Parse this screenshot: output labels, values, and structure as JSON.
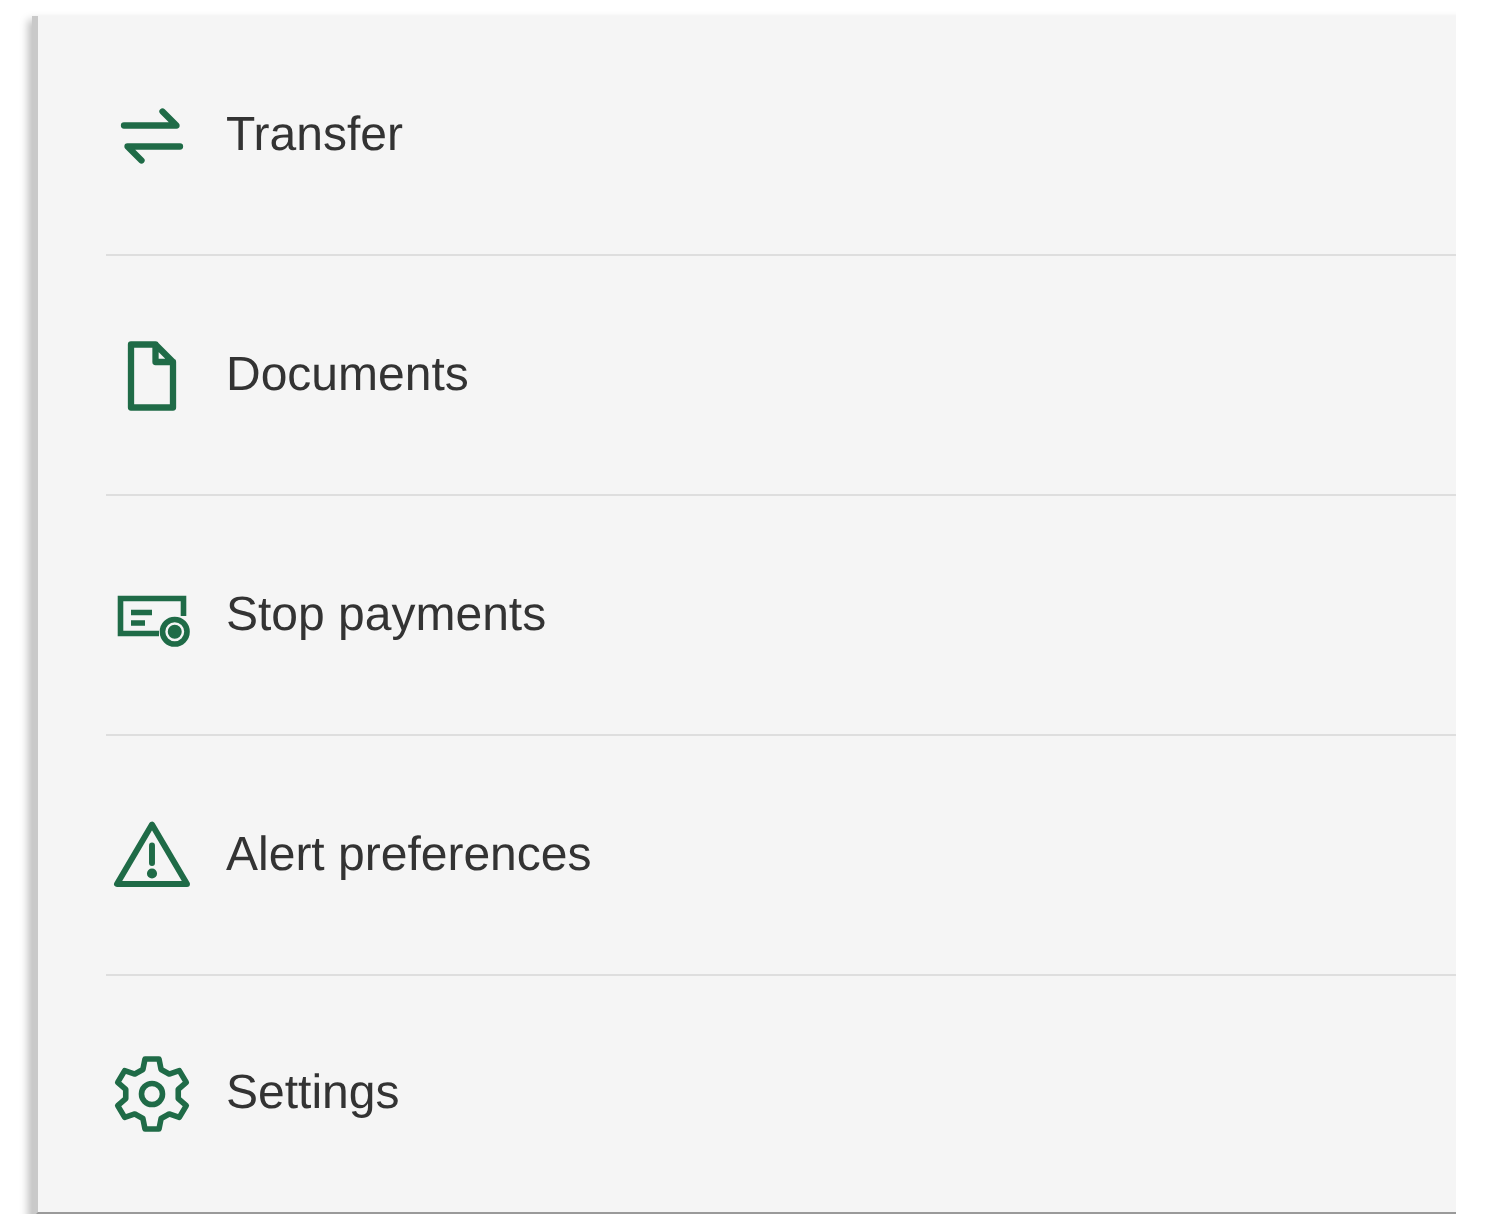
{
  "menu": {
    "items": [
      {
        "kind": "transfer",
        "label": "Transfer"
      },
      {
        "kind": "document",
        "label": "Documents"
      },
      {
        "kind": "stop-payment",
        "label": "Stop payments"
      },
      {
        "kind": "alert",
        "label": "Alert preferences"
      },
      {
        "kind": "settings",
        "label": "Settings"
      }
    ]
  }
}
